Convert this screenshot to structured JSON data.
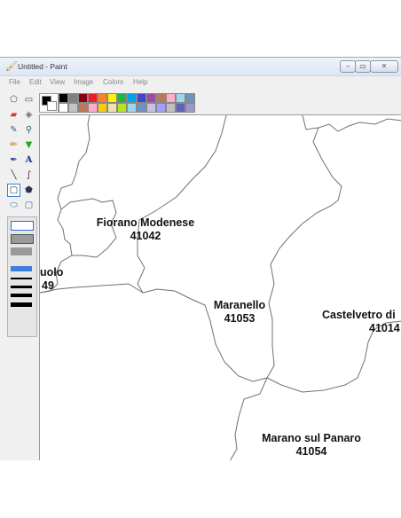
{
  "window": {
    "title": "Untitled - Paint",
    "controls": {
      "minimize": "–",
      "maximize": "▭",
      "close": "✕"
    }
  },
  "menu": [
    "File",
    "Edit",
    "View",
    "Image",
    "Colors",
    "Help"
  ],
  "tools": [
    {
      "name": "free-form-select-icon",
      "glyph": "⬠"
    },
    {
      "name": "rect-select-icon",
      "glyph": "▭"
    },
    {
      "name": "eraser-icon",
      "glyph": "▰"
    },
    {
      "name": "fill-bucket-icon",
      "glyph": "◈"
    },
    {
      "name": "color-picker-icon",
      "glyph": "✎"
    },
    {
      "name": "magnifier-icon",
      "glyph": "🔍"
    },
    {
      "name": "pencil-icon",
      "glyph": "✏"
    },
    {
      "name": "brush-icon",
      "glyph": "🖌"
    },
    {
      "name": "airbrush-icon",
      "glyph": "✒"
    },
    {
      "name": "text-icon",
      "glyph": "A"
    },
    {
      "name": "line-icon",
      "glyph": "╲"
    },
    {
      "name": "curve-icon",
      "glyph": "∫"
    },
    {
      "name": "rectangle-icon",
      "glyph": "▢"
    },
    {
      "name": "polygon-icon",
      "glyph": "⬟"
    },
    {
      "name": "ellipse-icon",
      "glyph": "⬭"
    },
    {
      "name": "rounded-rect-icon",
      "glyph": "▢"
    }
  ],
  "colors": {
    "foreground": "#000000",
    "background": "#ffffff",
    "palette_top": [
      "#000000",
      "#808080",
      "#800000",
      "#808000",
      "#008000",
      "#008080",
      "#000080",
      "#800080",
      "#808040",
      "#004040",
      "#0080ff",
      "#004080",
      "#8000ff",
      "#804000"
    ],
    "palette_top_visible": [
      "#000000",
      "#7f7f7f",
      "#880015",
      "#ed1c24",
      "#ff7f27",
      "#fff200",
      "#22b14c",
      "#00a2e8",
      "#3f48cc",
      "#a349a4",
      "#b97a57",
      "#ffaec9",
      "#99d9ea",
      "#7092be"
    ],
    "palette_bottom_visible": [
      "#ffffff",
      "#c3c3c3",
      "#b97a57",
      "#ffaec9",
      "#ffc90e",
      "#efe4b0",
      "#b5e61d",
      "#99d9ea",
      "#7092be",
      "#c8bfe7",
      "#a0a0ff",
      "#c0c0c0",
      "#6060c0",
      "#9999cc"
    ]
  },
  "map": {
    "labels": [
      {
        "name": "Fiorano Modenese",
        "code": "41042"
      },
      {
        "name": "uolo",
        "code": "49"
      },
      {
        "name": "Maranello",
        "code": "41053"
      },
      {
        "name": "Castelvetro di",
        "code": "41014"
      },
      {
        "name": "Marano sul Panaro",
        "code": "41054"
      }
    ]
  }
}
